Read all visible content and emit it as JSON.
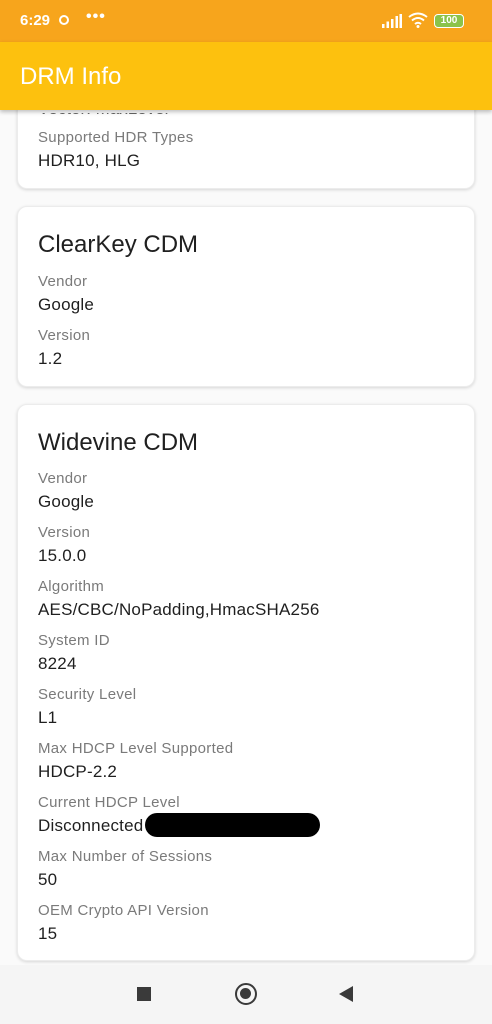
{
  "status_bar": {
    "time": "6:29",
    "dots": "•••",
    "battery": "100"
  },
  "app_bar": {
    "title": "DRM Info"
  },
  "cards": [
    {
      "cut_text": "Vector:  MaxLevel",
      "fields": [
        {
          "label": "Supported HDR Types",
          "value": "HDR10, HLG"
        }
      ]
    },
    {
      "title": "ClearKey CDM",
      "fields": [
        {
          "label": "Vendor",
          "value": "Google"
        },
        {
          "label": "Version",
          "value": "1.2"
        }
      ]
    },
    {
      "title": "Widevine CDM",
      "fields": [
        {
          "label": "Vendor",
          "value": "Google"
        },
        {
          "label": "Version",
          "value": "15.0.0"
        },
        {
          "label": "Algorithm",
          "value": "AES/CBC/NoPadding,HmacSHA256"
        },
        {
          "label": "System ID",
          "value": "8224"
        },
        {
          "label": "Security Level",
          "value": "L1"
        },
        {
          "label": "Max HDCP Level Supported",
          "value": "HDCP-2.2"
        },
        {
          "label": "Current HDCP Level",
          "value": "Disconnected"
        },
        {
          "label": "Max Number of Sessions",
          "value": "50"
        },
        {
          "label": "OEM Crypto API Version",
          "value": "15"
        }
      ]
    }
  ],
  "icons": {
    "status": [
      "ring-icon",
      "signal-icon",
      "wifi-icon",
      "battery-icon"
    ],
    "nav": [
      "recents-square-icon",
      "home-circle-icon",
      "back-triangle-icon"
    ]
  }
}
